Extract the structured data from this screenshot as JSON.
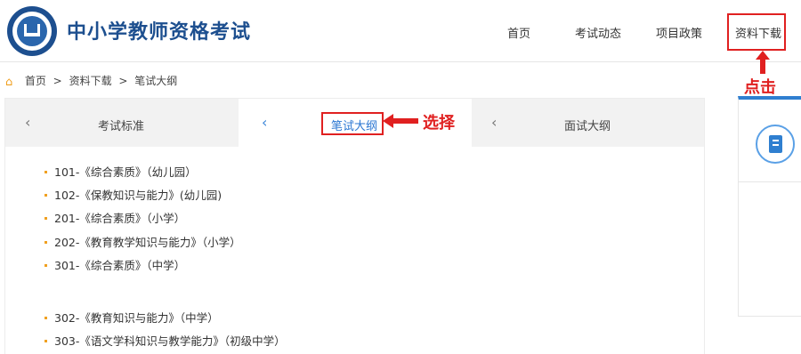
{
  "header": {
    "site_title": "中小学教师资格考试",
    "nav": {
      "home": "首页",
      "news": "考试动态",
      "policy": "项目政策",
      "download": "资料下载"
    }
  },
  "annotations": {
    "click": "点击",
    "select": "选择",
    "color": "#e02020"
  },
  "breadcrumb": {
    "icon": "home-icon",
    "items": [
      "首页",
      "资料下载",
      "笔试大纲"
    ],
    "separator": ">"
  },
  "tabs": [
    {
      "label": "考试标准",
      "active": false
    },
    {
      "label": "笔试大纲",
      "active": true
    },
    {
      "label": "面试大纲",
      "active": false
    }
  ],
  "documents": [
    "101-《综合素质》（幼儿园）",
    "102-《保教知识与能力》(幼儿园)",
    "201-《综合素质》（小学）",
    "202-《教育教学知识与能力》（小学）",
    "301-《综合素质》（中学）",
    "302-《教育知识与能力》（中学）",
    "303-《语文学科知识与教学能力》（初级中学）"
  ],
  "colors": {
    "brand": "#1d4f8f",
    "accent": "#2f7fd0",
    "bullet": "#f0a020"
  }
}
